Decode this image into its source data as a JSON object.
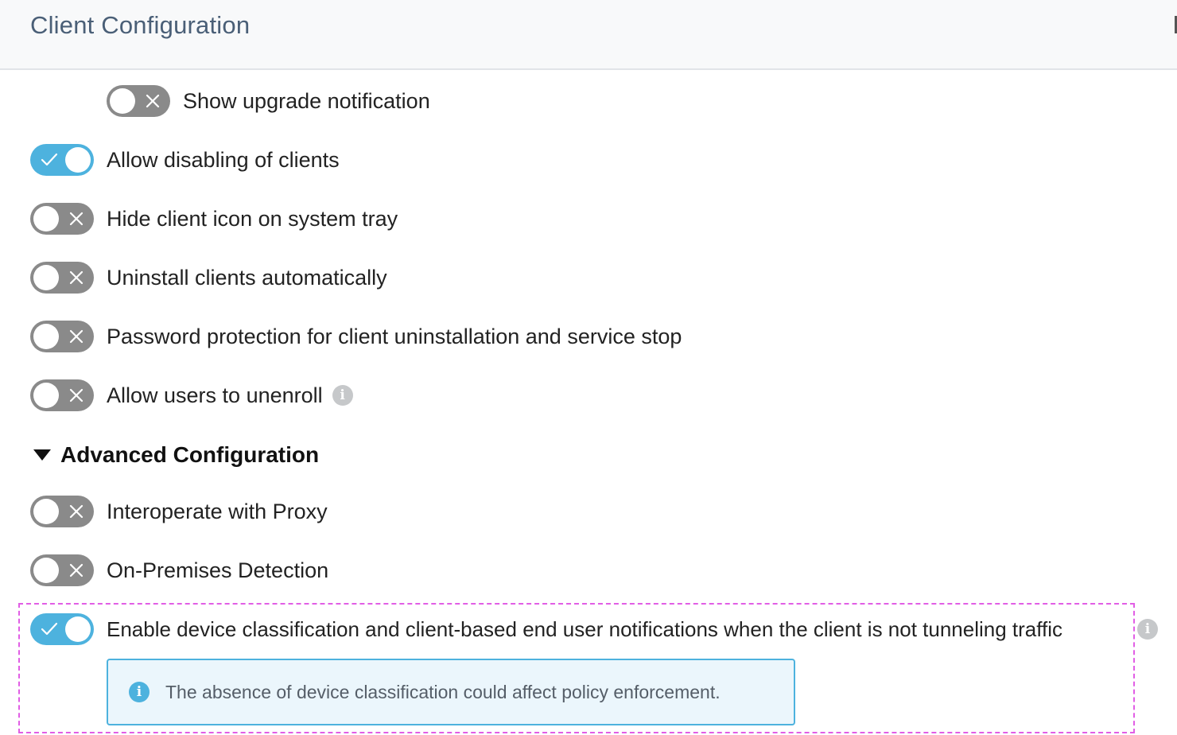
{
  "header": {
    "title": "Client Configuration"
  },
  "settings": [
    {
      "label": "Show upgrade notification",
      "state": "off"
    },
    {
      "label": "Allow disabling of clients",
      "state": "on"
    },
    {
      "label": "Hide client icon on system tray",
      "state": "off"
    },
    {
      "label": "Uninstall clients automatically",
      "state": "off"
    },
    {
      "label": "Password protection for client uninstallation and service stop",
      "state": "off"
    },
    {
      "label": "Allow users to unenroll",
      "state": "off",
      "info_icon": "info-icon"
    }
  ],
  "advanced": {
    "title": "Advanced Configuration",
    "expanded": true,
    "settings": [
      {
        "label": "Interoperate with Proxy",
        "state": "off"
      },
      {
        "label": "On-Premises Detection",
        "state": "off"
      },
      {
        "label": "Enable device classification and client-based end user notifications when the client is not tunneling traffic",
        "state": "on",
        "info_icon": "info-icon"
      }
    ],
    "notice": {
      "icon": "info-icon",
      "text": "The absence of device classification could affect policy enforcement."
    }
  },
  "icons": {
    "info_glyph": "i"
  },
  "colors": {
    "toggle_on": "#4db2de",
    "toggle_off": "#8a8a8a",
    "header_title": "#4a5f77",
    "highlight": "#e15ee5",
    "notice_border": "#4db2de",
    "notice_bg": "#ebf6fc"
  }
}
